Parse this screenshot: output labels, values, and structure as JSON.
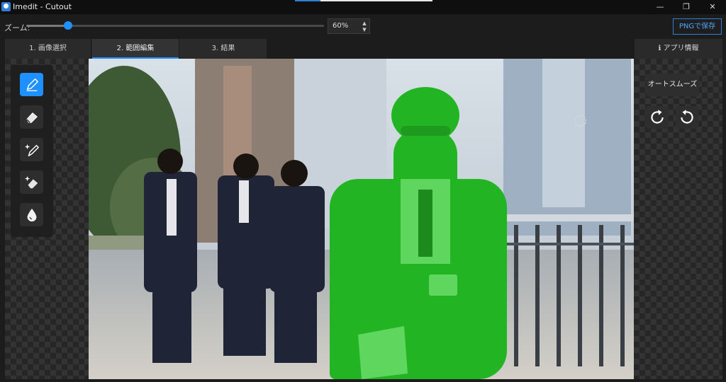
{
  "window": {
    "title": "Imedit - Cutout",
    "minimize_glyph": "—",
    "restore_glyph": "❐",
    "close_glyph": "✕"
  },
  "zoom": {
    "label": "ズーム:",
    "value_text": "60%",
    "level_fraction": 0.14
  },
  "toolbar": {
    "save_label": "PNGで保存"
  },
  "tabs": [
    {
      "label": "1. 画像選択",
      "active": false
    },
    {
      "label": "2. 範囲編集",
      "active": true
    },
    {
      "label": "3. 結果",
      "active": false
    }
  ],
  "info_tab": {
    "icon": "info-icon",
    "label": "アプリ情報"
  },
  "tools": [
    {
      "icon": "pencil-icon",
      "active": true
    },
    {
      "icon": "eraser-icon",
      "active": false
    },
    {
      "icon": "magic-pencil-icon",
      "active": false
    },
    {
      "icon": "magic-eraser-icon",
      "active": false
    },
    {
      "icon": "drop-icon",
      "active": false
    }
  ],
  "right_panel": {
    "smooth_label": "オートスムーズ",
    "rotate_buttons": [
      "rotate-cw-icon",
      "rotate-ccw-icon"
    ]
  },
  "colors": {
    "accent": "#1e90ff",
    "selection_overlay": "#22b422",
    "background": "#1c1c1c"
  }
}
